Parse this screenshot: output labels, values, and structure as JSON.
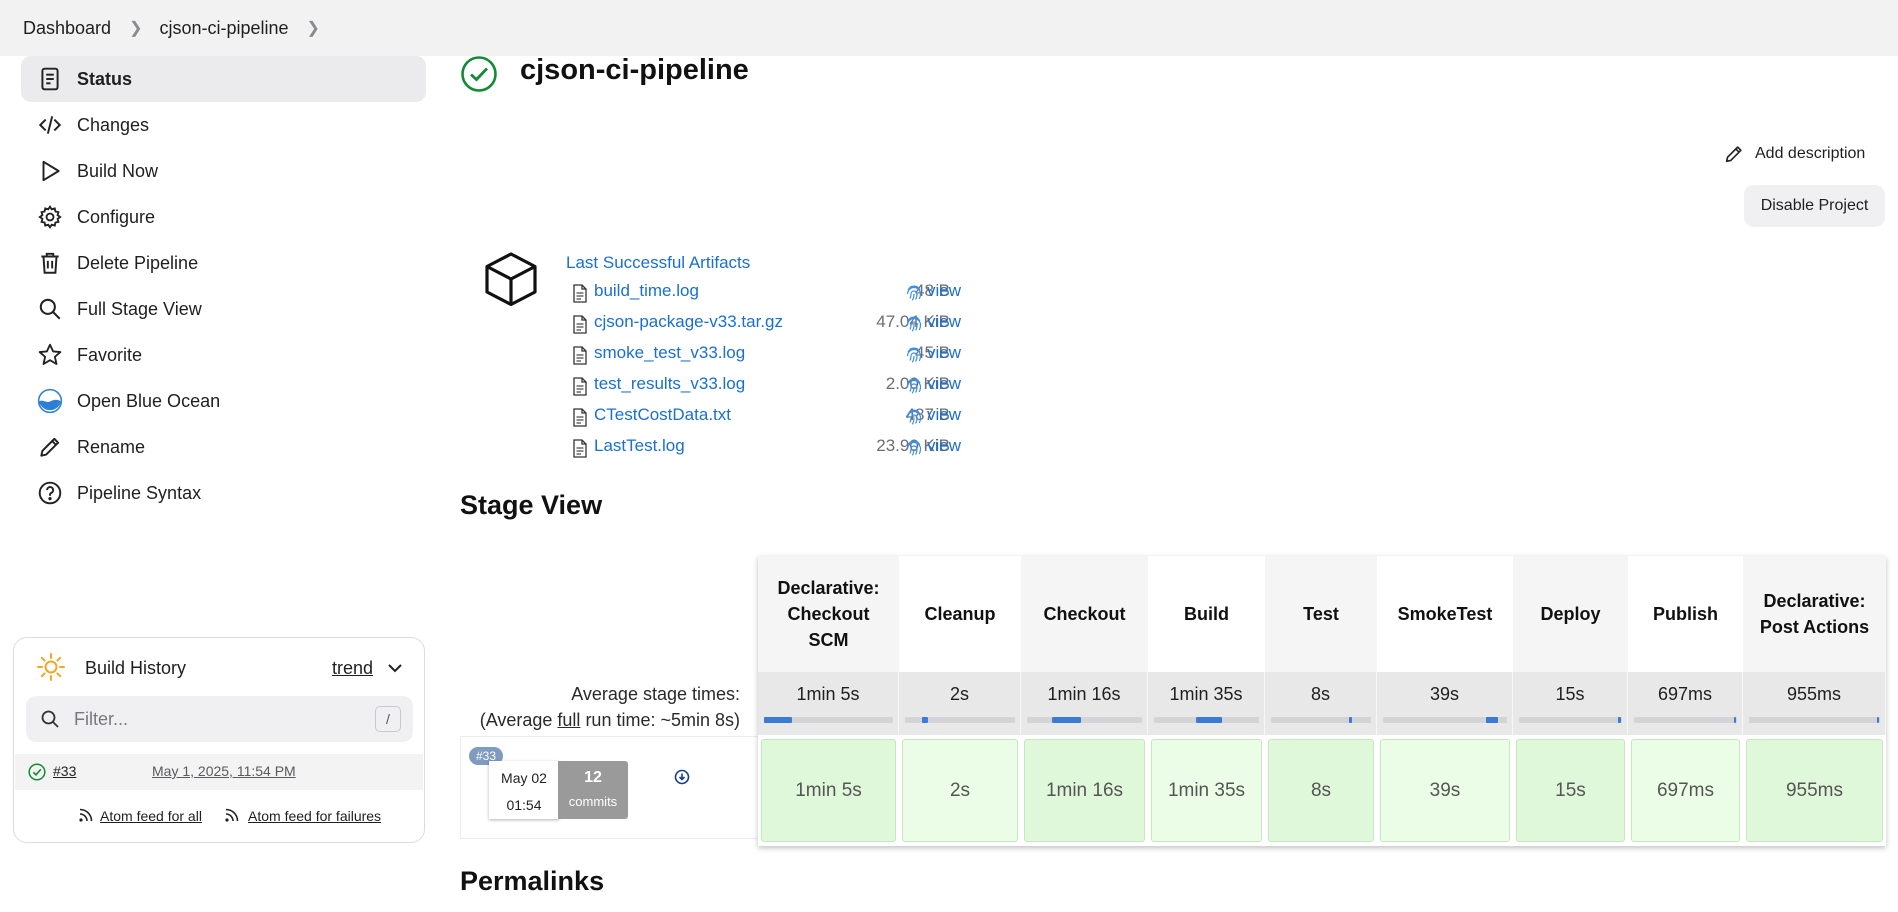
{
  "breadcrumb": {
    "items": [
      "Dashboard",
      "cjson-ci-pipeline"
    ]
  },
  "sidebar": {
    "items": [
      {
        "label": "Status",
        "icon": "status-doc-icon"
      },
      {
        "label": "Changes",
        "icon": "code-icon"
      },
      {
        "label": "Build Now",
        "icon": "play-icon"
      },
      {
        "label": "Configure",
        "icon": "gear-icon"
      },
      {
        "label": "Delete Pipeline",
        "icon": "trash-icon"
      },
      {
        "label": "Full Stage View",
        "icon": "search-icon"
      },
      {
        "label": "Favorite",
        "icon": "star-icon"
      },
      {
        "label": "Open Blue Ocean",
        "icon": "blue-ocean-icon"
      },
      {
        "label": "Rename",
        "icon": "pencil-icon"
      },
      {
        "label": "Pipeline Syntax",
        "icon": "help-icon"
      }
    ]
  },
  "build_history": {
    "title": "Build History",
    "trend_label": "trend",
    "filter_placeholder": "Filter...",
    "filter_shortcut": "/",
    "builds": [
      {
        "number": "#33",
        "date": "May 1, 2025, 11:54 PM",
        "status": "success"
      }
    ],
    "feed_all": "Atom feed for all",
    "feed_failures": "Atom feed for failures"
  },
  "main": {
    "title": "cjson-ci-pipeline",
    "add_description": "Add description",
    "disable_project": "Disable Project"
  },
  "artifacts": {
    "title": "Last Successful Artifacts",
    "view_label": "view",
    "files": [
      {
        "name": "build_time.log",
        "size": "48 B"
      },
      {
        "name": "cjson-package-v33.tar.gz",
        "size": "47.04 KiB"
      },
      {
        "name": "smoke_test_v33.log",
        "size": "45 B"
      },
      {
        "name": "test_results_v33.log",
        "size": "2.00 KiB"
      },
      {
        "name": "CTestCostData.txt",
        "size": "487 B"
      },
      {
        "name": "LastTest.log",
        "size": "23.90 KiB"
      }
    ]
  },
  "stage_view": {
    "title": "Stage View",
    "avg_label": "Average stage times:",
    "avg_full_prefix": "(Average ",
    "avg_full_word": "full",
    "avg_full_suffix": " run time: ~5min 8s)",
    "stages": [
      {
        "name": "Declarative: Checkout SCM",
        "avg": "1min 5s",
        "run": "1min 5s"
      },
      {
        "name": "Cleanup",
        "avg": "2s",
        "run": "2s"
      },
      {
        "name": "Checkout",
        "avg": "1min 16s",
        "run": "1min 16s"
      },
      {
        "name": "Build",
        "avg": "1min 35s",
        "run": "1min 35s"
      },
      {
        "name": "Test",
        "avg": "8s",
        "run": "8s"
      },
      {
        "name": "SmokeTest",
        "avg": "39s",
        "run": "39s"
      },
      {
        "name": "Deploy",
        "avg": "15s",
        "run": "15s"
      },
      {
        "name": "Publish",
        "avg": "697ms",
        "run": "697ms"
      },
      {
        "name": "Declarative: Post Actions",
        "avg": "955ms",
        "run": "955ms"
      }
    ],
    "build": {
      "badge": "#33",
      "date": "May 02",
      "time": "01:54",
      "commits_count": "12",
      "commits_label": "commits"
    }
  },
  "permalinks": {
    "title": "Permalinks"
  },
  "colors": {
    "accent": "#1a6fd1",
    "success": "#138a36",
    "stage_bg": "#e0f8da"
  }
}
